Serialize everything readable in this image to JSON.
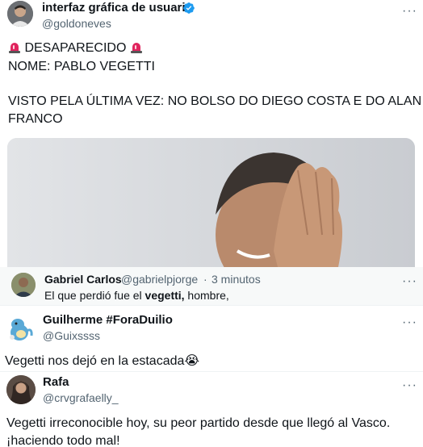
{
  "main_post": {
    "display_name": "interfaz gráfica de usuario",
    "handle": "@goldoneves",
    "more_label": "···",
    "lines": [
      "DESAPARECIDO",
      "NOME: PABLO VEGETTI",
      "VISTO PELA ÚLTIMA VEZ: NO BOLSO DO DIEGO COSTA E DO ALAN",
      "FRANCO"
    ],
    "icons": {
      "verified": "verified-badge-icon",
      "alarm": "police-light-emoji"
    },
    "colors": {
      "verified": "#1d9bf0",
      "siren": "#e0245e"
    }
  },
  "quoted_reply": {
    "display_name": "Gabriel Carlos",
    "handle": "@gabrielpjorge",
    "separator": "·",
    "time": "3 minutos",
    "text_before": "El que perdió fue el ",
    "text_bold": "vegetti,",
    "text_after": " hombre,",
    "more_label": "···"
  },
  "replies": [
    {
      "display_name": "Guilherme #ForaDuilio",
      "handle": "@Guixssss",
      "text": "Vegetti nos dejó en la estacada😭",
      "more_label": "···"
    },
    {
      "display_name": "Rafa",
      "handle": "@crvgrafaelly_",
      "text": "Vegetti irreconocible hoy, su peor partido desde que llegó al Vasco. ¡haciendo todo mal!",
      "more_label": "···"
    }
  ]
}
